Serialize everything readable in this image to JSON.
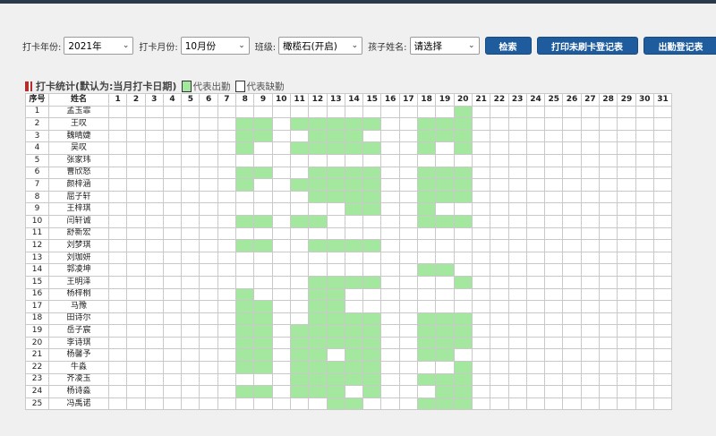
{
  "filters": {
    "year_label": "打卡年份:",
    "year_value": "2021年",
    "month_label": "打卡月份:",
    "month_value": "10月份",
    "class_label": "班级:",
    "class_value": "橄榄石(开启)",
    "child_label": "孩子姓名:",
    "child_value": "请选择"
  },
  "buttons": {
    "search": "检索",
    "print_unpunched": "打印未刷卡登记表",
    "attendance_register": "出勤登记表"
  },
  "section": {
    "title": "打卡统计(默认为:当月打卡日期)",
    "legend_present": "代表出勤",
    "legend_absent": "代表缺勤"
  },
  "colors": {
    "present": "#a4e8a0",
    "button": "#1f5c9e",
    "title_mark": "#b52d2d"
  },
  "table": {
    "headers": {
      "index": "序号",
      "name": "姓名"
    },
    "days": [
      1,
      2,
      3,
      4,
      5,
      6,
      7,
      8,
      9,
      10,
      11,
      12,
      13,
      14,
      15,
      16,
      17,
      18,
      19,
      20,
      21,
      22,
      23,
      24,
      25,
      26,
      27,
      28,
      29,
      30,
      31
    ],
    "rows": [
      {
        "no": "1",
        "name": "孟玉霏",
        "present": [
          20
        ]
      },
      {
        "no": "2",
        "name": "王叹",
        "present": [
          8,
          9,
          11,
          12,
          13,
          14,
          15,
          18,
          19,
          20
        ]
      },
      {
        "no": "3",
        "name": "魏晴婕",
        "present": [
          8,
          9,
          12,
          13,
          14,
          18,
          19,
          20
        ]
      },
      {
        "no": "4",
        "name": "吴叹",
        "present": [
          8,
          11,
          12,
          13,
          14,
          15,
          18,
          20
        ]
      },
      {
        "no": "5",
        "name": "张家玮",
        "present": []
      },
      {
        "no": "6",
        "name": "曹欣怒",
        "present": [
          8,
          9,
          12,
          13,
          14,
          15,
          18,
          19,
          20
        ]
      },
      {
        "no": "7",
        "name": "颜梓涵",
        "present": [
          8,
          11,
          12,
          13,
          14,
          15,
          18,
          19,
          20
        ]
      },
      {
        "no": "8",
        "name": "屈子轩",
        "present": [
          12,
          13,
          14,
          15,
          18,
          19,
          20
        ]
      },
      {
        "no": "9",
        "name": "王梓琪",
        "present": [
          14,
          15,
          18
        ]
      },
      {
        "no": "10",
        "name": "闫轩诚",
        "present": [
          8,
          9,
          11,
          12,
          18,
          19,
          20
        ]
      },
      {
        "no": "11",
        "name": "舒新宏",
        "present": []
      },
      {
        "no": "12",
        "name": "刘梦琪",
        "present": [
          8,
          9,
          12,
          13,
          14,
          15
        ]
      },
      {
        "no": "13",
        "name": "刘珈妍",
        "present": []
      },
      {
        "no": "14",
        "name": "郭凌坤",
        "present": [
          18,
          19
        ]
      },
      {
        "no": "15",
        "name": "王明泽",
        "present": [
          12,
          13,
          14,
          15,
          20
        ]
      },
      {
        "no": "16",
        "name": "杨梓桐",
        "present": [
          8,
          12,
          13
        ]
      },
      {
        "no": "17",
        "name": "马豫",
        "present": [
          8,
          9,
          12,
          13
        ]
      },
      {
        "no": "18",
        "name": "田诗尔",
        "present": [
          8,
          9,
          12,
          13,
          14,
          15,
          18,
          19,
          20
        ]
      },
      {
        "no": "19",
        "name": "岳子宸",
        "present": [
          8,
          9,
          11,
          12,
          13,
          14,
          15,
          18,
          19,
          20
        ]
      },
      {
        "no": "20",
        "name": "李诗琪",
        "present": [
          8,
          9,
          11,
          12,
          13,
          14,
          15,
          18,
          19,
          20
        ]
      },
      {
        "no": "21",
        "name": "杨馨予",
        "present": [
          8,
          9,
          11,
          12,
          14,
          15,
          18,
          19
        ]
      },
      {
        "no": "22",
        "name": "牛淼",
        "present": [
          8,
          9,
          11,
          12,
          13,
          14,
          15,
          20
        ]
      },
      {
        "no": "23",
        "name": "齐凌玉",
        "present": [
          11,
          12,
          13,
          14,
          15,
          18,
          19,
          20
        ]
      },
      {
        "no": "24",
        "name": "杨诗淼",
        "present": [
          8,
          9,
          11,
          12,
          13,
          15,
          19,
          20
        ]
      },
      {
        "no": "25",
        "name": "冯禹诺",
        "present": [
          13,
          14,
          18,
          19,
          20
        ]
      }
    ]
  }
}
